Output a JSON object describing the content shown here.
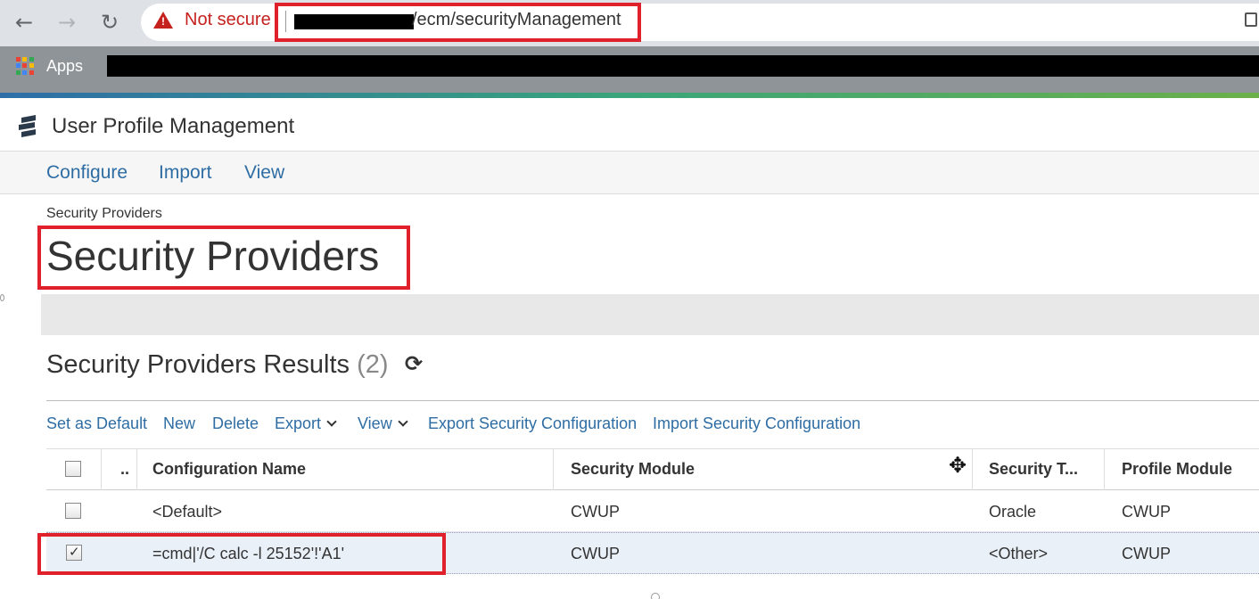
{
  "browser": {
    "security_label": "Not secure",
    "url_visible": "/ecm/securityManagement",
    "bookmarks_apps_label": "Apps"
  },
  "app": {
    "title": "User Profile Management",
    "menu": [
      "Configure",
      "Import",
      "View"
    ]
  },
  "page": {
    "breadcrumb": "Security Providers",
    "title": "Security Providers"
  },
  "results": {
    "title": "Security Providers Results",
    "count": "(2)"
  },
  "actions": {
    "set_default": "Set as Default",
    "new": "New",
    "delete": "Delete",
    "export": "Export",
    "view": "View",
    "export_config": "Export Security Configuration",
    "import_config": "Import Security Configuration"
  },
  "table": {
    "headers": {
      "more": "..",
      "config_name": "Configuration Name",
      "security_module": "Security Module",
      "security_type": "Security T...",
      "profile_module": "Profile Module"
    },
    "rows": [
      {
        "checked": false,
        "config_name": "<Default>",
        "security_module": "CWUP",
        "security_type": "Oracle",
        "profile_module": "CWUP"
      },
      {
        "checked": true,
        "config_name": "=cmd|'/C calc -l 25152'!'A1'",
        "security_module": "CWUP",
        "security_type": "<Other>",
        "profile_module": "CWUP"
      }
    ]
  },
  "colors": {
    "link": "#2e6da4",
    "highlight_box": "#e0202a",
    "warning": "#c5221f",
    "selected_row": "#e9f0f8"
  }
}
